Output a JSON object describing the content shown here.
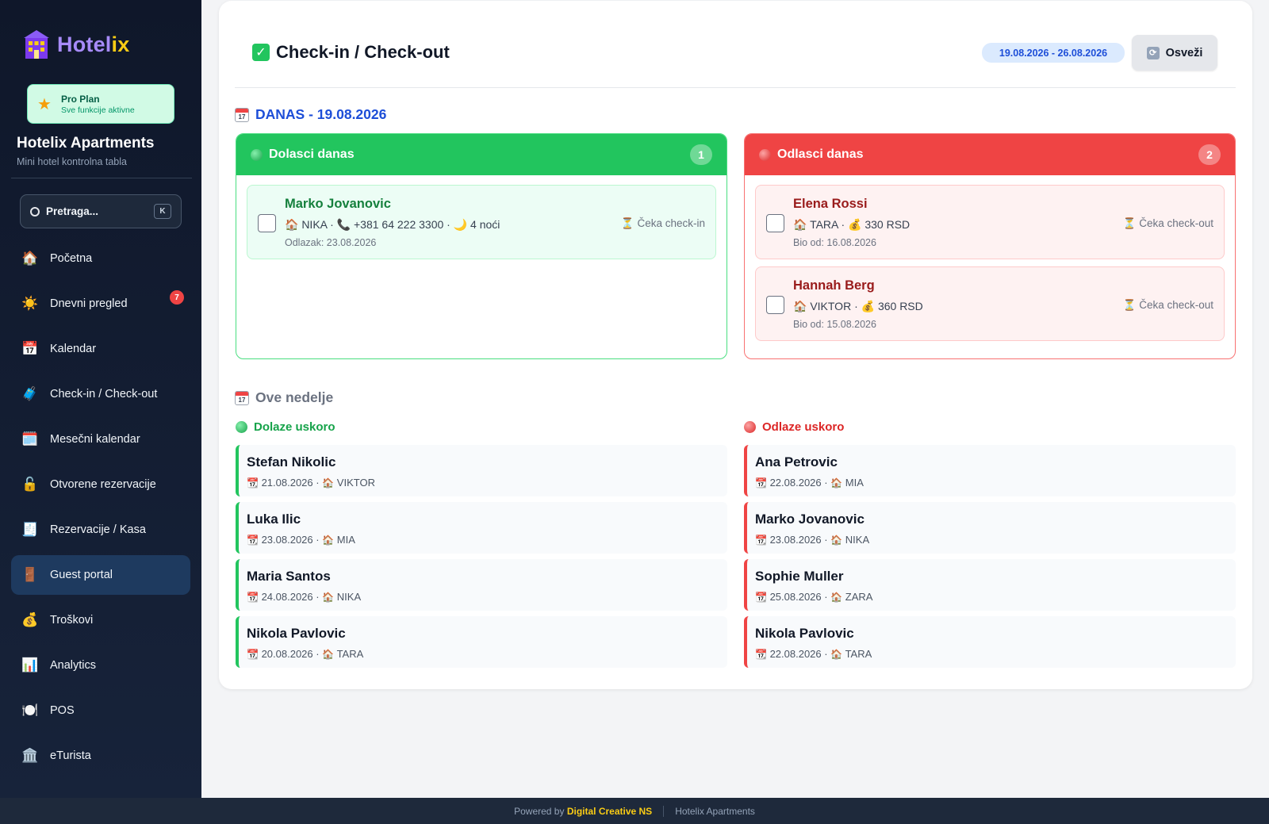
{
  "sidebar": {
    "logo_a": "Hotel",
    "logo_b": "ix",
    "plan_title": "Pro Plan",
    "plan_sub": "Sve funkcije aktivne",
    "hotel_name": "Hotelix Apartments",
    "hotel_sub": "Mini hotel kontrolna tabla",
    "search_placeholder": "Pretraga...",
    "search_shortcut": "K",
    "items": [
      {
        "label": "Početna",
        "icon": "🏠"
      },
      {
        "label": "Dnevni pregled",
        "icon": "☀️",
        "badge": "7"
      },
      {
        "label": "Kalendar",
        "icon": "📅"
      },
      {
        "label": "Check-in / Check-out",
        "icon": "🧳"
      },
      {
        "label": "Mesečni kalendar",
        "icon": "🗓️"
      },
      {
        "label": "Otvorene rezervacije",
        "icon": "🔓"
      },
      {
        "label": "Rezervacije / Kasa",
        "icon": "🧾"
      },
      {
        "label": "Guest portal",
        "icon": "🚪",
        "active": true
      },
      {
        "label": "Troškovi",
        "icon": "💰"
      },
      {
        "label": "Analytics",
        "icon": "📊"
      },
      {
        "label": "POS",
        "icon": "🍽️"
      },
      {
        "label": "eTurista",
        "icon": "🏛️"
      }
    ]
  },
  "header": {
    "title": "Check-in / Check-out",
    "date_range": "19.08.2026 - 26.08.2026",
    "refresh_label": "Osveži"
  },
  "today": {
    "title": "DANAS - 19.08.2026",
    "arrivals": {
      "title": "Dolasci danas",
      "count": "1",
      "guests": [
        {
          "name": "Marko Jovanovic",
          "meta": "🏠 NIKA · 📞 +381 64 222 3300 · 🌙 4 noći",
          "sub": "Odlazak: 23.08.2026",
          "status": "⏳ Čeka check-in"
        }
      ]
    },
    "departures": {
      "title": "Odlasci danas",
      "count": "2",
      "guests": [
        {
          "name": "Elena Rossi",
          "meta": "🏠 TARA · 💰 330 RSD",
          "sub": "Bio od: 16.08.2026",
          "status": "⏳ Čeka check-out"
        },
        {
          "name": "Hannah Berg",
          "meta": "🏠 VIKTOR · 💰 360 RSD",
          "sub": "Bio od: 15.08.2026",
          "status": "⏳ Čeka check-out"
        }
      ]
    }
  },
  "week": {
    "title": "Ove nedelje",
    "arriving_title": "Dolaze uskoro",
    "departing_title": "Odlaze uskoro",
    "arriving": [
      {
        "name": "Stefan Nikolic",
        "date": "21.08.2026",
        "room": "VIKTOR"
      },
      {
        "name": "Luka Ilic",
        "date": "23.08.2026",
        "room": "MIA"
      },
      {
        "name": "Maria Santos",
        "date": "24.08.2026",
        "room": "NIKA"
      },
      {
        "name": "Nikola Pavlovic",
        "date": "20.08.2026",
        "room": "TARA"
      }
    ],
    "departing": [
      {
        "name": "Ana Petrovic",
        "date": "22.08.2026",
        "room": "MIA"
      },
      {
        "name": "Marko Jovanovic",
        "date": "23.08.2026",
        "room": "NIKA"
      },
      {
        "name": "Sophie Muller",
        "date": "25.08.2026",
        "room": "ZARA"
      },
      {
        "name": "Nikola Pavlovic",
        "date": "22.08.2026",
        "room": "TARA"
      }
    ]
  },
  "footer": {
    "powered": "Powered by",
    "brand": "Digital Creative NS",
    "app": "Hotelix Apartments"
  }
}
